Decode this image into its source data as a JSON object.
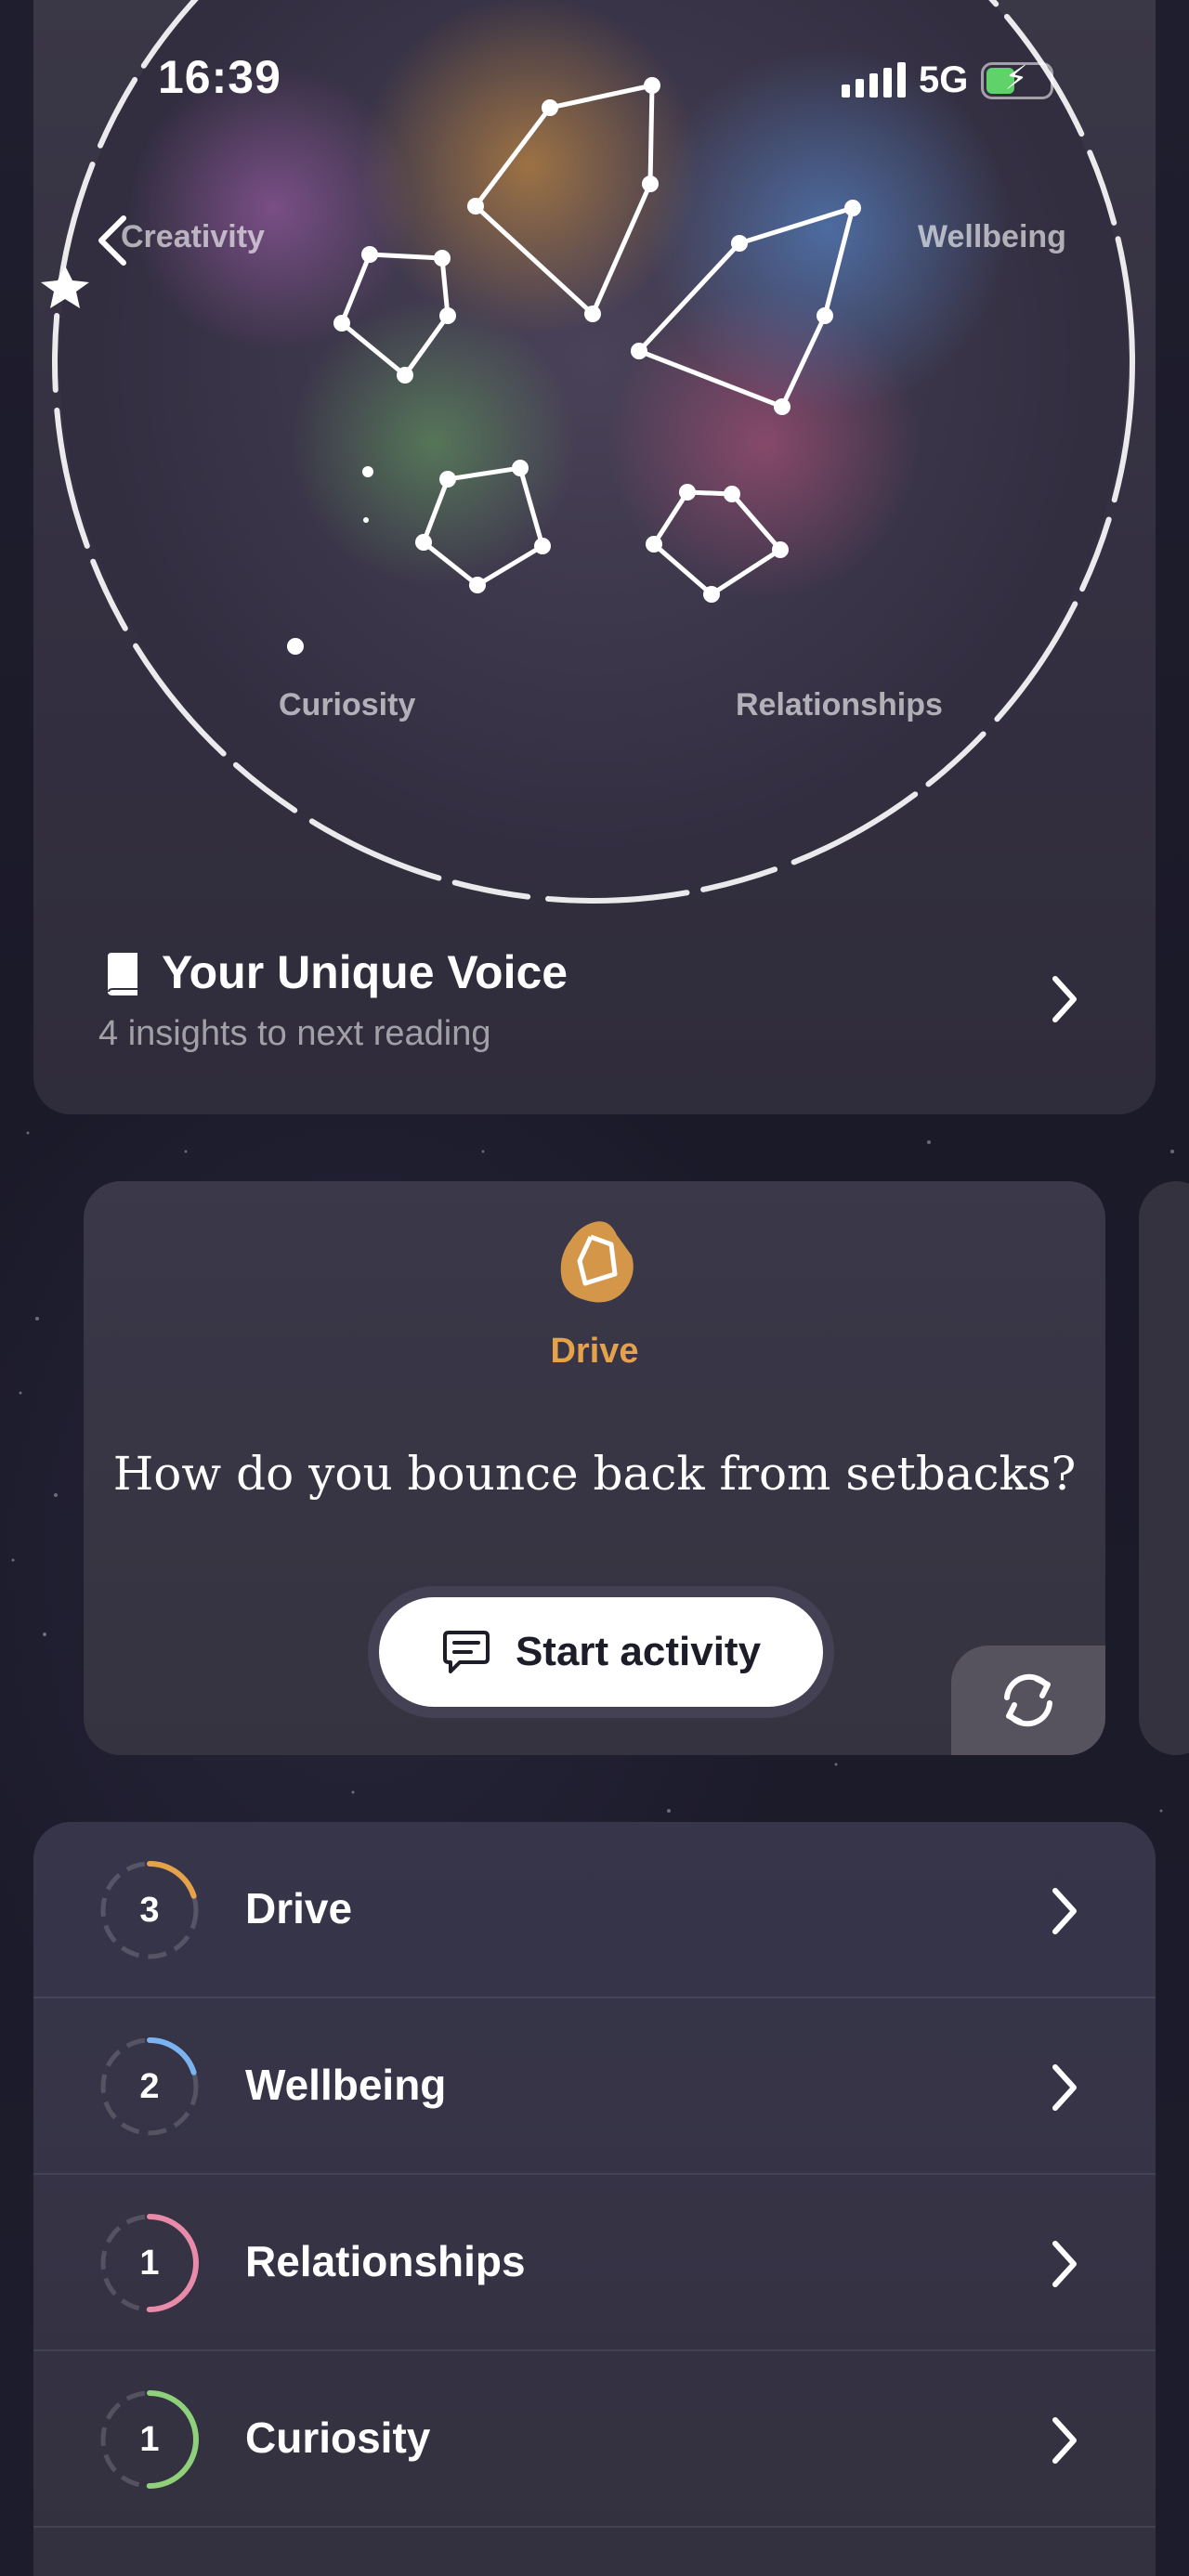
{
  "status_bar": {
    "time": "16:39",
    "network": "5G"
  },
  "constellation": {
    "labels": {
      "creativity": "Creativity",
      "wellbeing": "Wellbeing",
      "curiosity": "Curiosity",
      "relationships": "Relationships"
    }
  },
  "voice": {
    "title": "Your Unique Voice",
    "subtitle": "4 insights to next reading",
    "icon": "book-icon"
  },
  "question_card": {
    "category": "Drive",
    "question": "How do you bounce back from setbacks?",
    "button_label": "Start activity",
    "button_icon": "chat-icon",
    "refresh_icon": "refresh-icon"
  },
  "colors": {
    "drive": "#e6a24a",
    "wellbeing": "#7ab3ef",
    "relationships": "#e88aa8",
    "curiosity": "#8fd07a",
    "creativity": "#c98ad6"
  },
  "categories": [
    {
      "count": "3",
      "label": "Drive",
      "progress": 0.2
    },
    {
      "count": "2",
      "label": "Wellbeing",
      "progress": 0.2
    },
    {
      "count": "1",
      "label": "Relationships",
      "progress": 0.5
    },
    {
      "count": "1",
      "label": "Curiosity",
      "progress": 0.5
    }
  ]
}
